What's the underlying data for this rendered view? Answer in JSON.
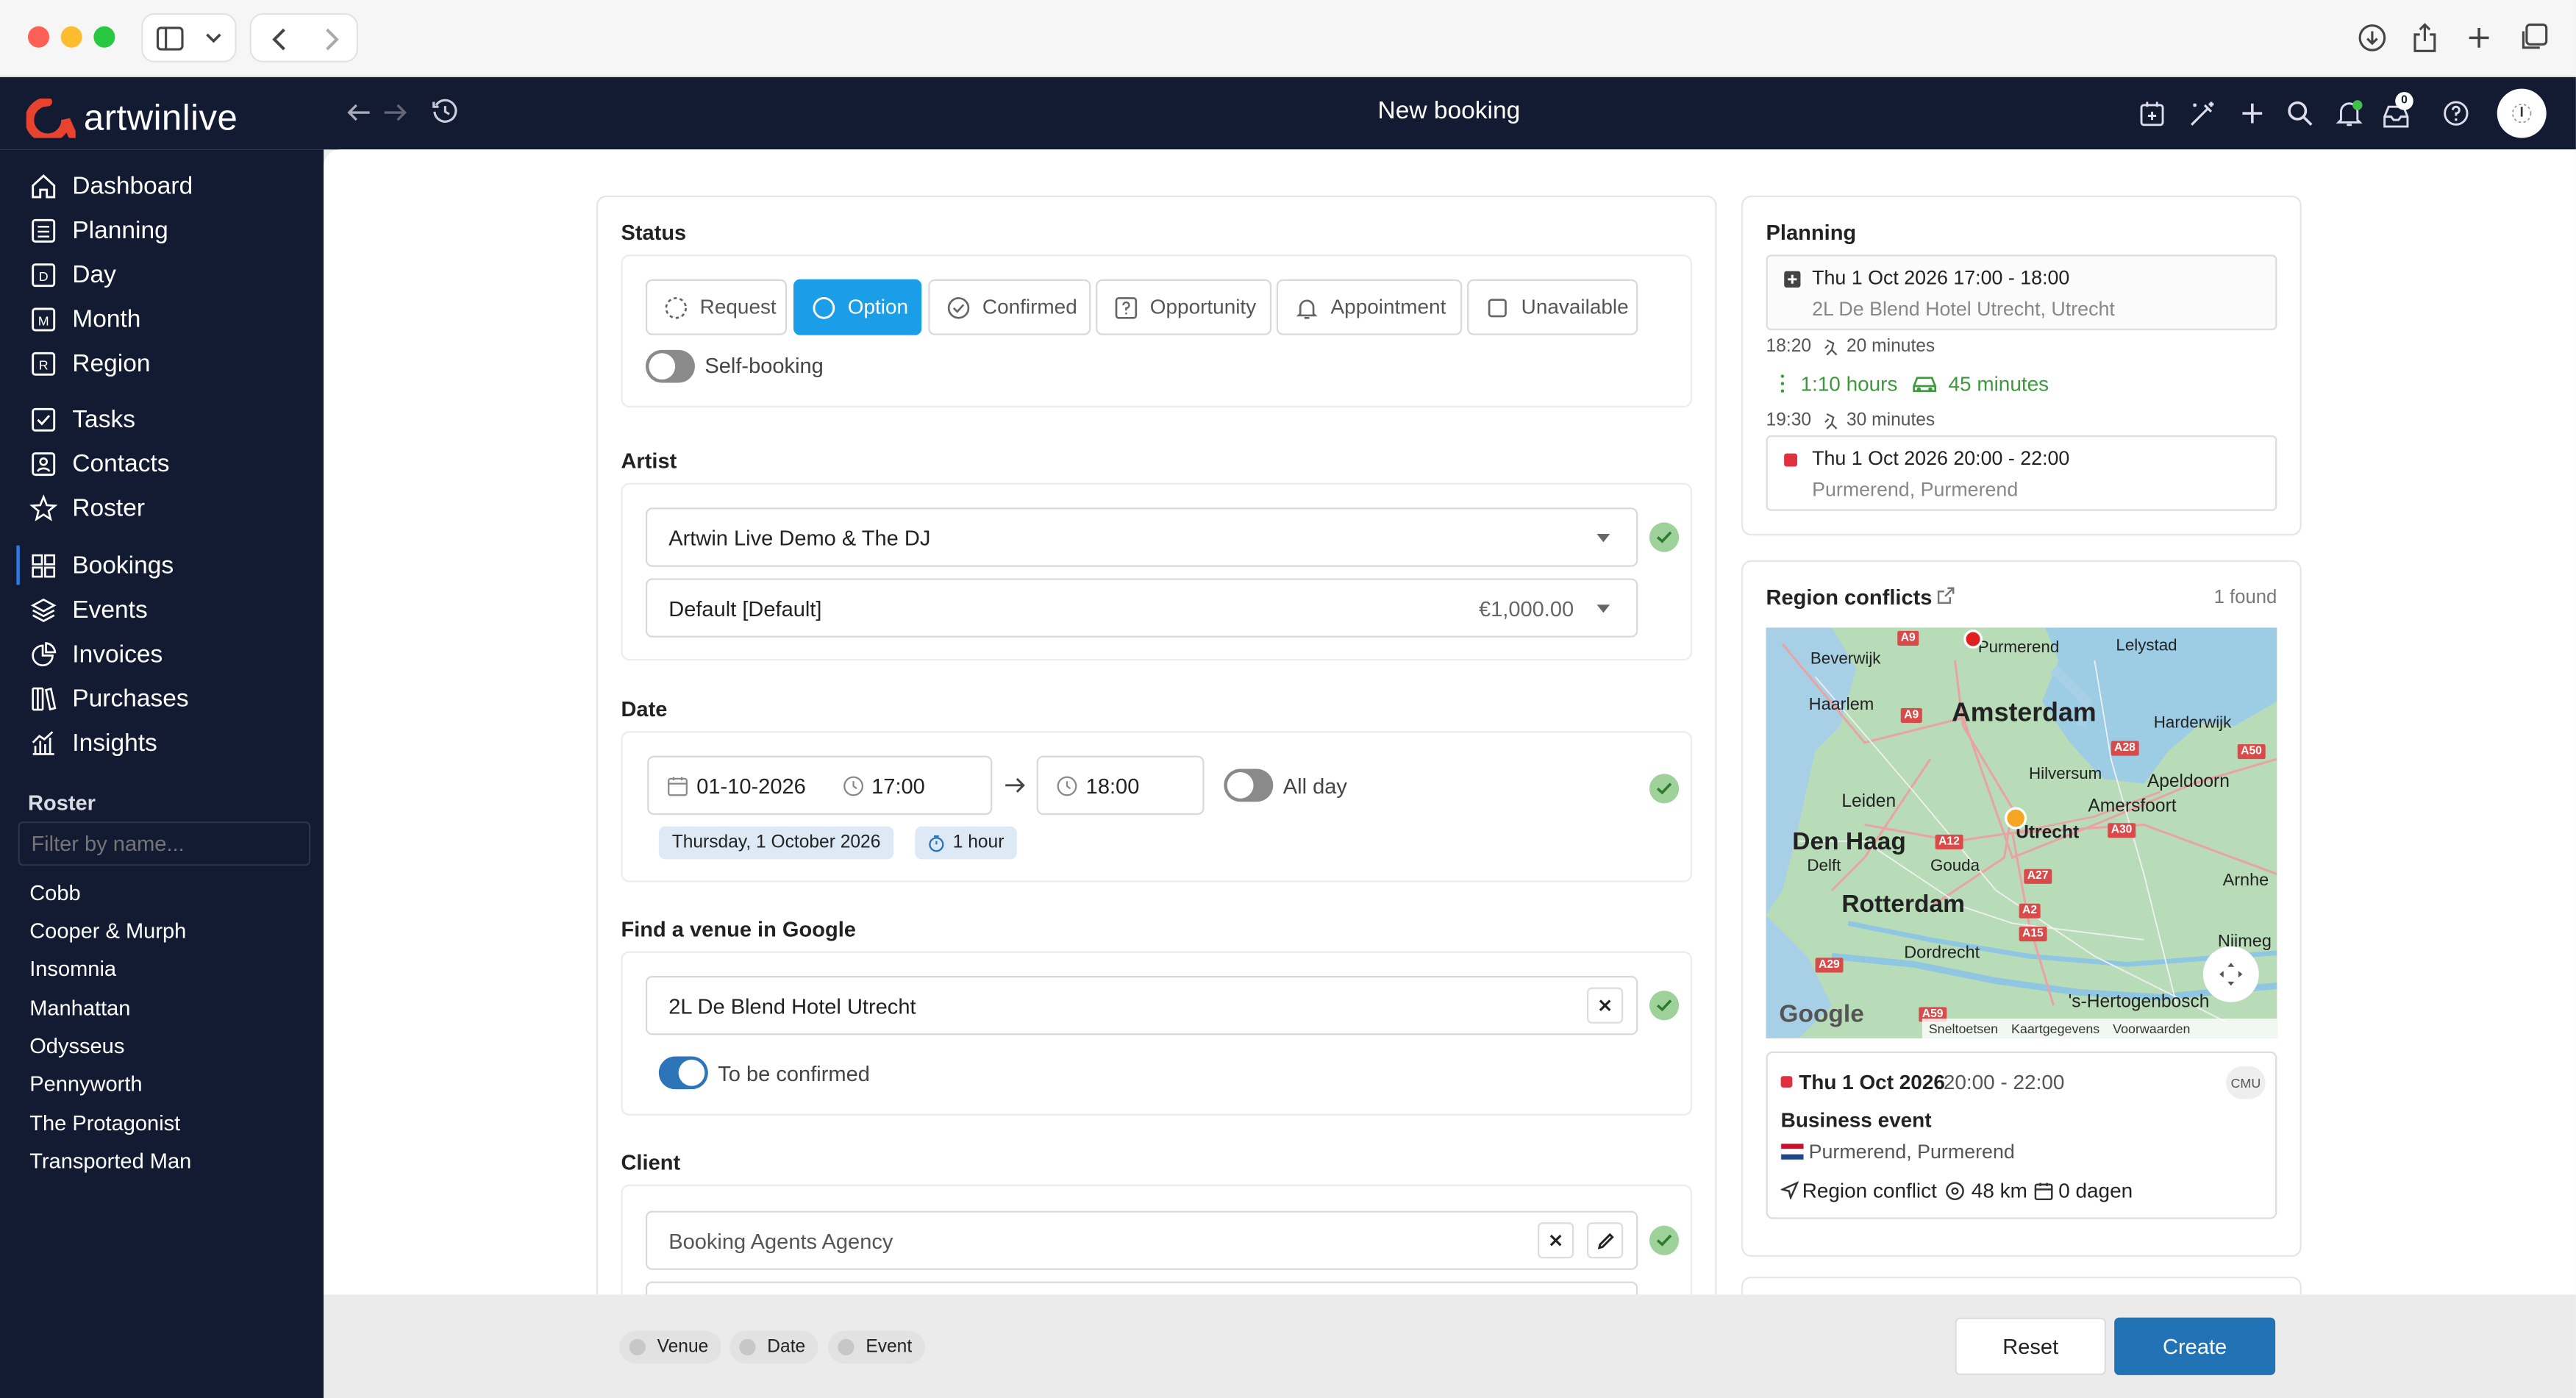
{
  "browser": {
    "nav_back": "back",
    "nav_forward": "forward"
  },
  "app": {
    "logo": "artwinlive",
    "title": "New booking",
    "notification_count": "0"
  },
  "sidebar": {
    "nav": [
      "Dashboard",
      "Planning",
      "Day",
      "Month",
      "Region",
      "Tasks",
      "Contacts",
      "Roster",
      "Bookings",
      "Events",
      "Invoices",
      "Purchases",
      "Insights"
    ],
    "roster_title": "Roster",
    "filter_placeholder": "Filter by name...",
    "roster_items": [
      "Cobb",
      "Cooper & Murph",
      "Insomnia",
      "Manhattan",
      "Odysseus",
      "Pennyworth",
      "The Protagonist",
      "Transported Man"
    ]
  },
  "form": {
    "status": {
      "title": "Status",
      "options": [
        "Request",
        "Option",
        "Confirmed",
        "Opportunity",
        "Appointment",
        "Unavailable"
      ],
      "selected": "Option",
      "self_booking": "Self-booking"
    },
    "artist": {
      "title": "Artist",
      "name": "Artwin Live Demo & The DJ",
      "deal": "Default [Default]",
      "fee": "€1,000.00"
    },
    "date": {
      "title": "Date",
      "date": "01-10-2026",
      "start": "17:00",
      "end": "18:00",
      "all_day": "All day",
      "day_label": "Thursday, 1 October 2026",
      "duration": "1 hour"
    },
    "venue": {
      "title": "Find a venue in Google",
      "value": "2L De Blend Hotel Utrecht",
      "to_be_confirmed": "To be confirmed"
    },
    "client": {
      "title": "Client",
      "value": "Booking Agents Agency"
    }
  },
  "planning": {
    "title": "Planning",
    "event1": {
      "datetime": "Thu 1 Oct 2026 17:00 - 18:00",
      "location": "2L De Blend Hotel Utrecht, Utrecht"
    },
    "t1": "18:20",
    "t1_dur": "20 minutes",
    "travel_hours": "1:10 hours",
    "travel_drive": "45 minutes",
    "t2": "19:30",
    "t2_dur": "30 minutes",
    "event2": {
      "datetime": "Thu 1 Oct 2026 20:00 - 22:00",
      "location": "Purmerend, Purmerend"
    }
  },
  "conflicts": {
    "title": "Region conflicts",
    "count": "1 found",
    "map": {
      "labels": [
        "Beverwijk",
        "Purmerend",
        "Lelystad",
        "Haarlem",
        "Amsterdam",
        "Harderwijk",
        "Hilversum",
        "Apeldoorn",
        "Leiden",
        "Amersfoort",
        "Den Haag",
        "Utrecht",
        "Delft",
        "Gouda",
        "Arnhe",
        "Rotterdam",
        "Nijmeg",
        "Dordrecht",
        "'s-Hertogenbosch"
      ],
      "roads": [
        "A9",
        "A9",
        "A28",
        "A50",
        "A12",
        "A30",
        "A27",
        "A2",
        "A15",
        "A29",
        "A59"
      ],
      "google": "Google",
      "footer": [
        "Sneltoetsen",
        "Kaartgegevens",
        "Voorwaarden"
      ]
    },
    "item": {
      "date": "Thu 1 Oct 2026",
      "time": "20:00 - 22:00",
      "avatar": "CMU",
      "event": "Business event",
      "location": "Purmerend, Purmerend",
      "conflict": "Region conflict",
      "distance": "48 km",
      "days": "0 dagen"
    }
  },
  "footer": {
    "chips": [
      "Venue",
      "Date",
      "Event"
    ],
    "reset": "Reset",
    "create": "Create"
  },
  "colors": {
    "navy": "#131b33",
    "accent": "#1a9ee8",
    "primary": "#2272b6",
    "green": "#3c9a3c",
    "red": "#e03040"
  }
}
